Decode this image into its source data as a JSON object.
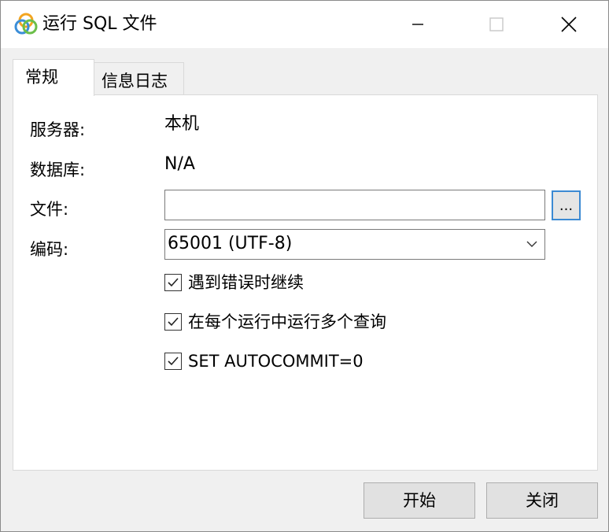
{
  "window": {
    "title": "运行 SQL 文件",
    "controls": {
      "minimize_icon": "minimize-icon",
      "maximize_icon": "maximize-icon",
      "close_icon": "close-icon"
    }
  },
  "tabs": [
    {
      "label": "常规",
      "active": true
    },
    {
      "label": "信息日志",
      "active": false
    }
  ],
  "form": {
    "server_label": "服务器:",
    "server_value": "本机",
    "database_label": "数据库:",
    "database_value": "N/A",
    "file_label": "文件:",
    "file_value": "",
    "browse_label": "...",
    "encoding_label": "编码:",
    "encoding_value": "65001 (UTF-8)"
  },
  "options": [
    {
      "label": "遇到错误时继续",
      "checked": true
    },
    {
      "label": "在每个运行中运行多个查询",
      "checked": true
    },
    {
      "label": "SET AUTOCOMMIT=0",
      "checked": true
    }
  ],
  "buttons": {
    "start": "开始",
    "close": "关闭"
  },
  "colors": {
    "focus_border": "#3c8ad3",
    "window_bg": "#f0f0f0",
    "panel_bg": "#ffffff"
  }
}
